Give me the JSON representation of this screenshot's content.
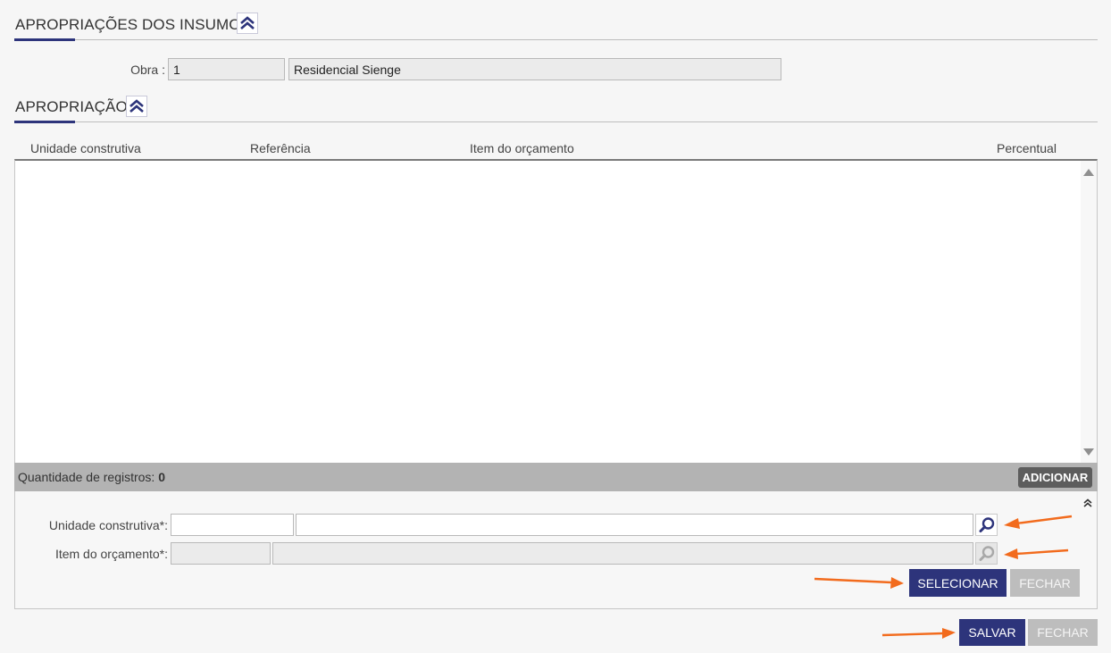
{
  "section_insumos": {
    "title": "APROPRIAÇÕES DOS INSUMOS"
  },
  "obra": {
    "label": "Obra :",
    "code": "1",
    "name": "Residencial Sienge"
  },
  "section_apropriacao": {
    "title": "APROPRIAÇÃO"
  },
  "grid": {
    "columns": [
      "Unidade construtiva",
      "Referência",
      "Item do orçamento",
      "Percentual"
    ],
    "footer_label": "Quantidade de registros:",
    "footer_count": "0",
    "add_button": "ADICIONAR"
  },
  "form": {
    "unidade_label": "Unidade construtiva*:",
    "item_label": "Item do orçamento*:",
    "select_button": "SELECIONAR",
    "close_button": "FECHAR"
  },
  "actions": {
    "save_button": "SALVAR",
    "close_button": "FECHAR"
  },
  "colors": {
    "primary": "#2d347b",
    "annotation_arrow": "#f26b1d"
  },
  "icons": [
    "collapse-up-icon",
    "search-icon",
    "scroll-up-icon",
    "scroll-down-icon",
    "collapse-panel-icon"
  ]
}
